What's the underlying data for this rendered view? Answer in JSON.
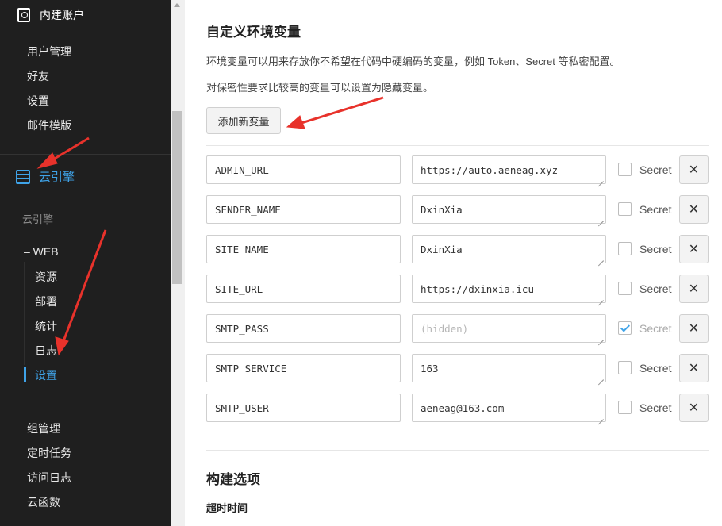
{
  "sidebar": {
    "account_title": "内建账户",
    "account_items": [
      "用户管理",
      "好友",
      "设置",
      "邮件模版"
    ],
    "engine_title": "云引擎",
    "engine_subtitle": "云引擎",
    "web_label": "– WEB",
    "web_items": [
      "资源",
      "部署",
      "统计",
      "日志",
      "设置"
    ],
    "active_web_item": "设置",
    "bottom_items": [
      "组管理",
      "定时任务",
      "访问日志",
      "云函数"
    ]
  },
  "main": {
    "title": "自定义环境变量",
    "desc1": "环境变量可以用来存放你不希望在代码中硬编码的变量，例如 Token、Secret 等私密配置。",
    "desc2": "对保密性要求比较高的变量可以设置为隐藏变量。",
    "add_button": "添加新变量",
    "secret_label": "Secret",
    "delete_glyph": "✕",
    "variables": [
      {
        "key": "ADMIN_URL",
        "value": "https://auto.aeneag.xyz",
        "secret": false
      },
      {
        "key": "SENDER_NAME",
        "value": "DxinXia",
        "secret": false
      },
      {
        "key": "SITE_NAME",
        "value": "DxinXia",
        "secret": false
      },
      {
        "key": "SITE_URL",
        "value": "https://dxinxia.icu",
        "secret": false
      },
      {
        "key": "SMTP_PASS",
        "value": "",
        "placeholder": "(hidden)",
        "secret": true
      },
      {
        "key": "SMTP_SERVICE",
        "value": "163",
        "secret": false
      },
      {
        "key": "SMTP_USER",
        "value": "aeneag@163.com",
        "secret": false
      }
    ],
    "build_title": "构建选项",
    "timeout_label": "超时时间"
  },
  "colors": {
    "sidebar_bg": "#1f1f1f",
    "accent": "#3fa3e8",
    "annotation_red": "#e8322b"
  }
}
